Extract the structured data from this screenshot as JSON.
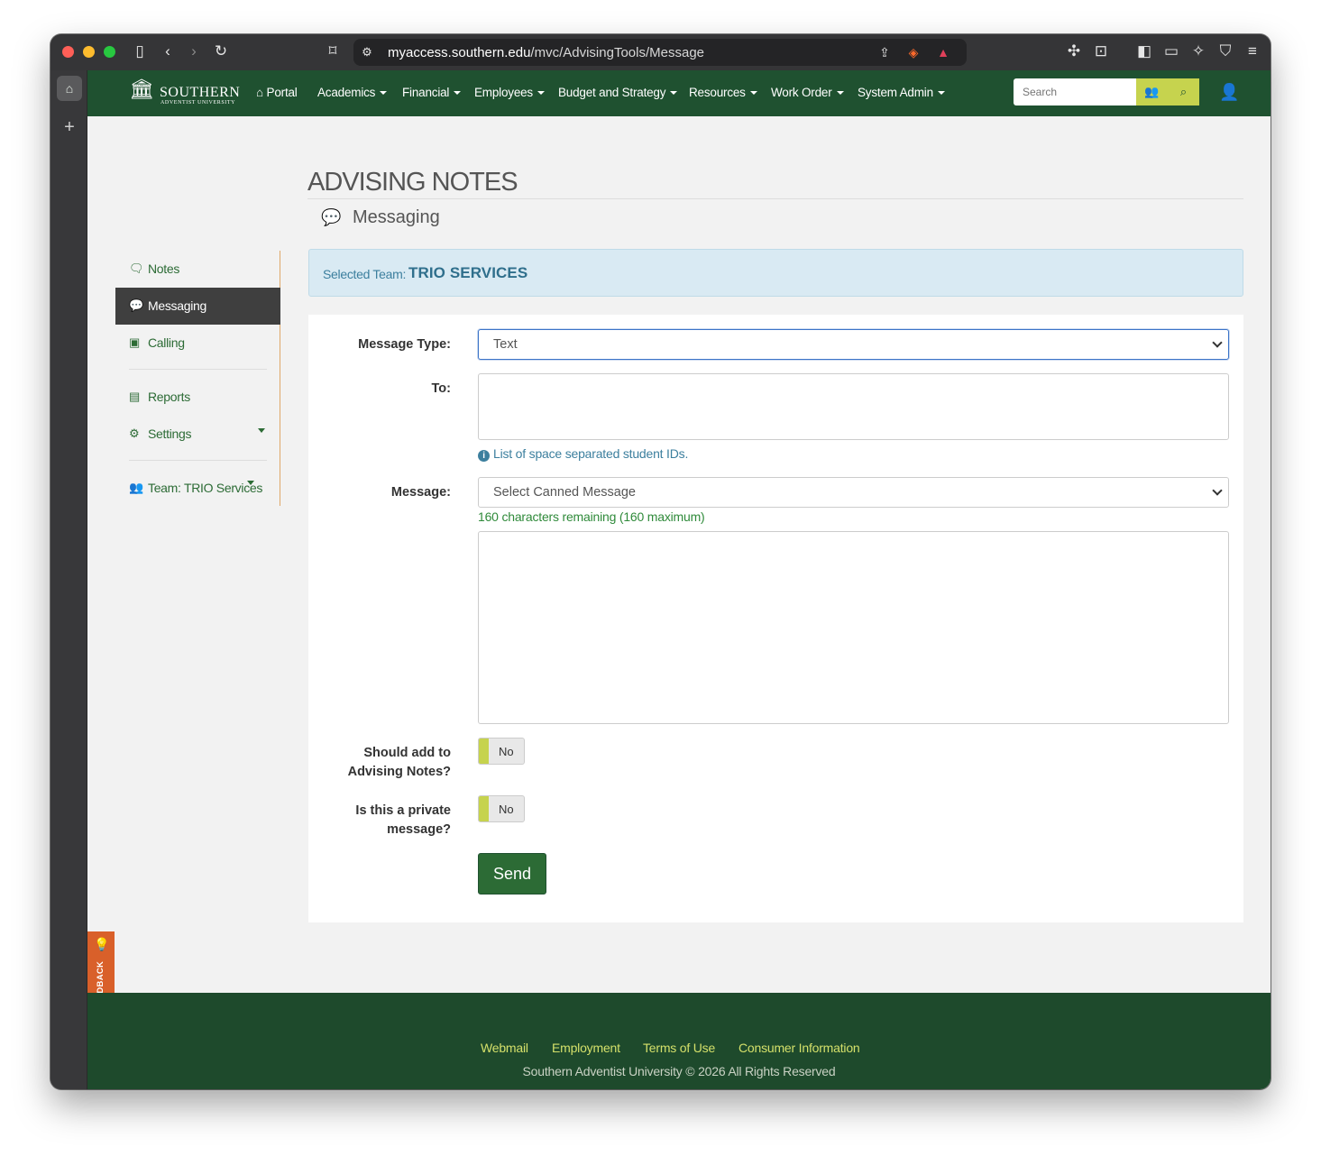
{
  "browser": {
    "url_domain": "myaccess.southern.edu",
    "url_path": "/mvc/AdvisingTools/Message"
  },
  "navbar": {
    "logo_name": "SOUTHERN",
    "logo_sub": "ADVENTIST UNIVERSITY",
    "items": [
      {
        "label": "Portal",
        "icon": "home-icon"
      },
      {
        "label": "Academics"
      },
      {
        "label": "Financial"
      },
      {
        "label": "Employees"
      },
      {
        "label": "Budget and Strategy"
      },
      {
        "label": "Resources"
      },
      {
        "label": "Work Order"
      },
      {
        "label": "System Admin"
      }
    ],
    "search_placeholder": "Search"
  },
  "header": {
    "title": "ADVISING NOTES",
    "subtitle": "Messaging"
  },
  "sidebar": {
    "items": [
      {
        "label": "Notes",
        "icon": "comments-icon"
      },
      {
        "label": "Messaging",
        "icon": "comment-icon",
        "active": true
      },
      {
        "label": "Calling",
        "icon": "phone-book-icon"
      },
      {
        "label": "Reports",
        "icon": "file-icon"
      },
      {
        "label": "Settings",
        "icon": "gears-icon"
      },
      {
        "label": "Team: TRIO Services",
        "icon": "users-icon"
      }
    ]
  },
  "team_banner": {
    "label": "Selected Team:",
    "value": "TRIO SERVICES"
  },
  "form": {
    "message_type_label": "Message Type:",
    "message_type_value": "Text",
    "to_label": "To:",
    "to_value": "",
    "to_help": "List of space separated student IDs.",
    "message_label": "Message:",
    "canned_message_value": "Select Canned Message",
    "counter": "160 characters remaining (160 maximum)",
    "message_value": "",
    "add_notes_label_1": "Should add to",
    "add_notes_label_2": "Advising Notes?",
    "add_notes_value": "No",
    "private_label_1": "Is this a private",
    "private_label_2": "message?",
    "private_value": "No",
    "send_label": "Send"
  },
  "feedback": {
    "label": "FEEDBACK"
  },
  "footer": {
    "links": [
      "Webmail",
      "Employment",
      "Terms of Use",
      "Consumer Information"
    ],
    "copyright": "Southern Adventist University © 2026 All Rights Reserved"
  },
  "colors": {
    "brand_green": "#1f5130",
    "accent_lime": "#c6d34e",
    "info_blue": "#d9eaf3",
    "feedback_orange": "#d9602a"
  }
}
